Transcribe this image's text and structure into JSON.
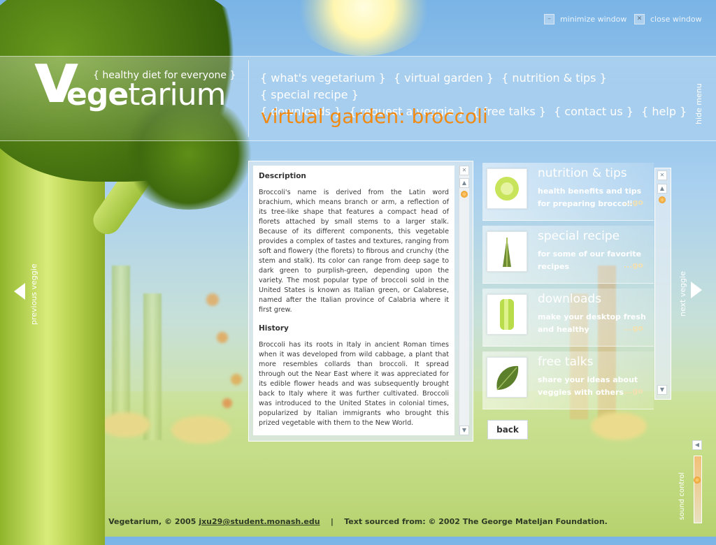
{
  "window": {
    "minimize_label": "minimize window",
    "close_label": "close window"
  },
  "brand": {
    "logo_v": "v",
    "logo_rest_bold": "ege",
    "logo_rest_light": "tarium",
    "tagline": "{ healthy diet for everyone }"
  },
  "nav": {
    "items": [
      "{ what's vegetarium }",
      "{ virtual garden }",
      "{ nutrition & tips }",
      "{ special recipe }",
      "{ downloads }",
      "{ request a veggie }",
      "{ free talks }",
      "{ contact us }",
      "{ help }"
    ],
    "hide_menu": "hide menu"
  },
  "page_title": "virtual garden:  broccoli",
  "side": {
    "previous": "previous veggie",
    "next": "next veggie"
  },
  "description": {
    "heading1": "Description",
    "para1": "Broccoli's name is derived from the Latin word brachium, which means branch or arm, a reflection of its tree-like shape that features a compact head of florets attached by small stems to a larger stalk. Because of its different components, this vegetable provides a complex of tastes and textures, ranging from soft and flowery (the florets) to fibrous and crunchy (the stem and stalk). Its color can range from deep sage to dark green to purplish-green, depending upon the variety. The most popular type of broccoli sold in the United States is known as Italian green, or Calabrese, named after the Italian province of Calabria where it first grew.",
    "heading2": "History",
    "para2": "Broccoli has its roots in Italy in ancient Roman times when it was developed from wild cabbage, a plant that more resembles collards than broccoli. It spread through out the Near East where it was appreciated for its edible flower heads and was subsequently brought back to Italy where it was further cultivated. Broccoli was introduced to the United States in colonial times, popularized by Italian immigrants who brought this prized vegetable with them to the New World."
  },
  "cards": [
    {
      "title": "nutrition & tips",
      "desc": "health benefits and tips for preparing broccoli",
      "go": "...go"
    },
    {
      "title": "special recipe",
      "desc": "for some of our favorite recipes",
      "go": "...go"
    },
    {
      "title": "downloads",
      "desc": "make your desktop fresh and healthy",
      "go": "...go"
    },
    {
      "title": "free talks",
      "desc": "share your ideas about veggies with others",
      "go": "...go"
    }
  ],
  "back_label": "back",
  "sound_label": "sound control",
  "footer": {
    "prefix": "Vegetarium, © 2005",
    "email": "jxu29@student.monash.edu",
    "separator": "|",
    "source": "Text sourced from: © 2002 The George Mateljan Foundation."
  },
  "colors": {
    "accent": "#f08a12",
    "sky": "#7ab4e6",
    "grass": "#b9d67a"
  }
}
